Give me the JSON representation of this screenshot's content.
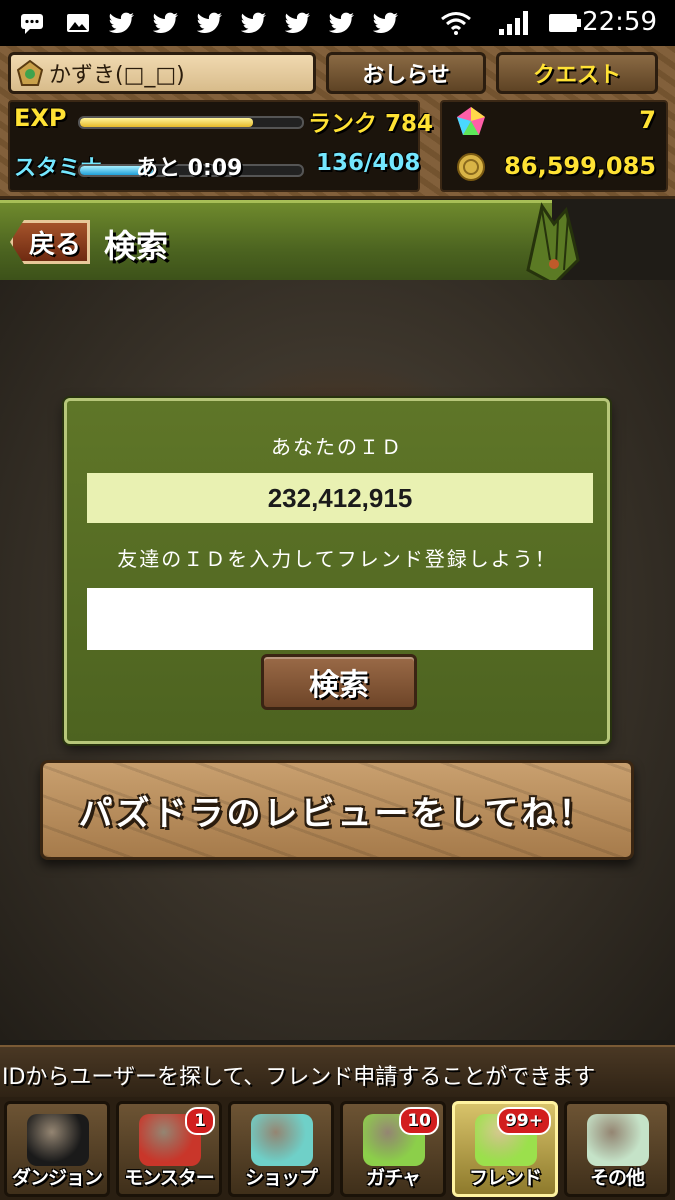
{
  "status_bar": {
    "time": "22:59",
    "icons": [
      "chat-icon",
      "image-icon",
      "twitter-icon",
      "twitter-icon",
      "twitter-icon",
      "twitter-icon",
      "twitter-icon",
      "twitter-icon",
      "twitter-icon",
      "wifi-icon",
      "signal-icon",
      "battery-icon"
    ]
  },
  "header": {
    "player_name": "かずき(□_□)",
    "news_button": "おしらせ",
    "quest_button": "クエスト",
    "exp_label": "EXP",
    "exp_fraction": 0.78,
    "rank_text": "ランク 784",
    "stamina_label": "スタミナ",
    "stamina_timer": "あと 0:09",
    "stamina_fraction": 0.33,
    "stamina_value": "136/408",
    "magic_stones": "7",
    "coins": "86,599,085"
  },
  "banner": {
    "back_label": "戻る",
    "title": "検索"
  },
  "dialog": {
    "your_id_label": "あなたのＩＤ",
    "your_id": "232,412,915",
    "prompt": "友達のＩＤを入力してフレンド登録しよう！",
    "input_value": "",
    "search_button": "検索"
  },
  "review_button": "パズドラのレビューをしてね！",
  "info_text": "IDからユーザーを探して、フレンド申請することができます",
  "bottom_nav": [
    {
      "label": "ダンジョン",
      "badge": "",
      "icon": "dungeon-gate-icon",
      "color": "#1a1a1a",
      "active": false
    },
    {
      "label": "モンスター",
      "badge": "1",
      "icon": "red-dragon-icon",
      "color": "#c9362a",
      "active": false
    },
    {
      "label": "ショップ",
      "badge": "",
      "icon": "rainbow-gem-icon",
      "color": "#6fd0c8",
      "active": false
    },
    {
      "label": "ガチャ",
      "badge": "10",
      "icon": "egg-icon",
      "color": "#8ccf4a",
      "active": false
    },
    {
      "label": "フレンド",
      "badge": "99+",
      "icon": "friends-icon",
      "color": "#9be04c",
      "active": true
    },
    {
      "label": "その他",
      "badge": "",
      "icon": "question-mark-icon",
      "color": "#c5e3c8",
      "active": false
    }
  ]
}
